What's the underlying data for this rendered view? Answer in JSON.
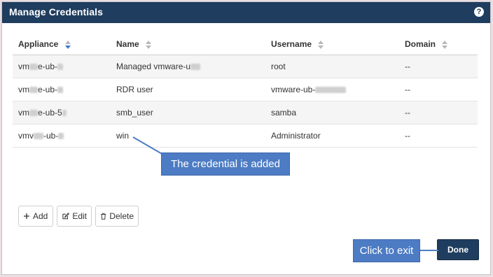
{
  "dialog": {
    "title": "Manage Credentials",
    "help_label": "?"
  },
  "table": {
    "columns": [
      "Appliance",
      "Name",
      "Username",
      "Domain"
    ],
    "rows": [
      {
        "appliance_prefix": "vm",
        "appliance_suffix": "e-ub-",
        "name": "Managed vmware-u",
        "username": "root",
        "domain": "--"
      },
      {
        "appliance_prefix": "vm",
        "appliance_suffix": "e-ub-",
        "name": "RDR user",
        "username": "vmware-ub-",
        "domain": "--"
      },
      {
        "appliance_prefix": "vm",
        "appliance_suffix": "e-ub-5",
        "name": "smb_user",
        "username": "samba",
        "domain": "--"
      },
      {
        "appliance_prefix": "vmv",
        "appliance_suffix": "-ub-",
        "name": "win",
        "username": "Administrator",
        "domain": "--"
      }
    ]
  },
  "actions": {
    "add": "Add",
    "edit": "Edit",
    "delete": "Delete",
    "done": "Done"
  },
  "callouts": {
    "added": "The credential is added",
    "exit": "Click to exit"
  },
  "colors": {
    "titlebar": "#1f3d5f",
    "callout": "#4d7cc4",
    "sort_active": "#3a7bd5"
  }
}
